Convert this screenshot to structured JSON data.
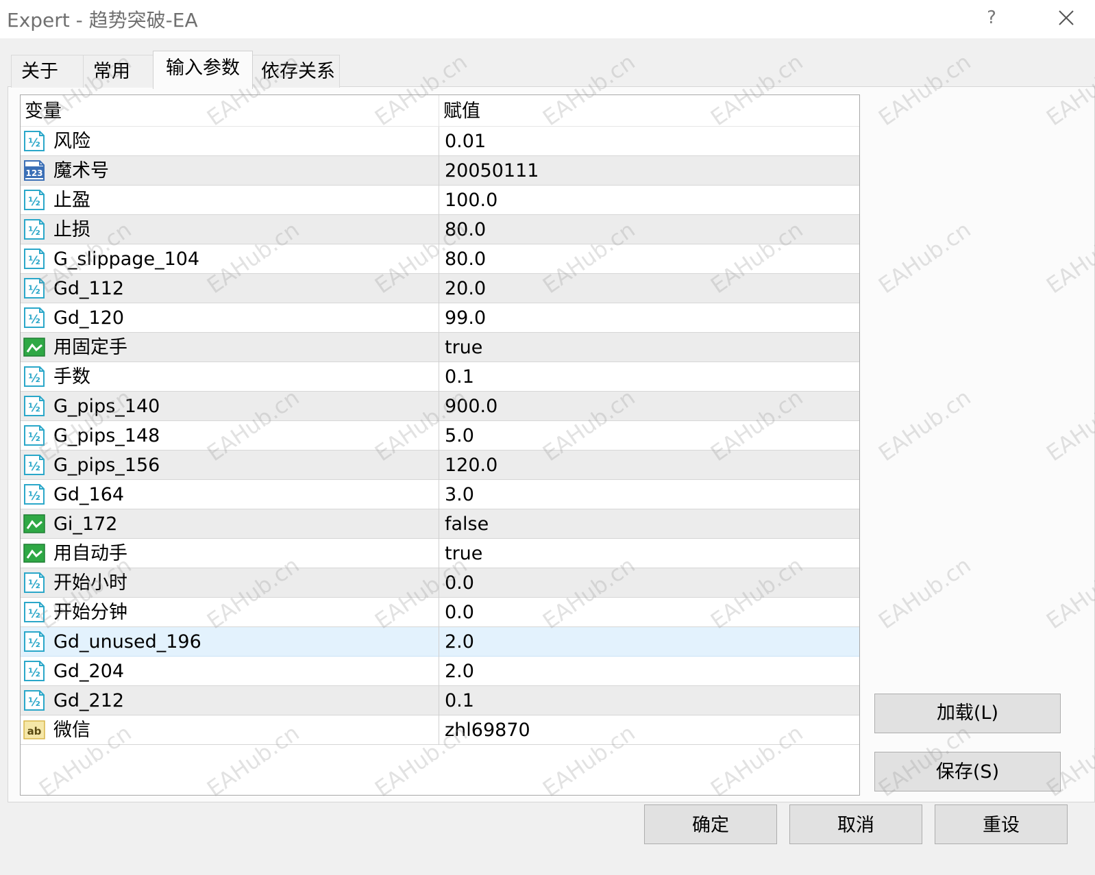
{
  "window": {
    "title": "Expert - 趋势突破-EA",
    "help_label": "?"
  },
  "tabs": [
    {
      "label": "关于"
    },
    {
      "label": "常用"
    },
    {
      "label": "输入参数",
      "active": true
    },
    {
      "label": "依存关系"
    }
  ],
  "grid": {
    "columns": [
      "变量",
      "赋值"
    ],
    "rows": [
      {
        "icon": "fraction-icon",
        "name": "风险",
        "value": "0.01"
      },
      {
        "icon": "integer-icon",
        "name": "魔术号",
        "value": "20050111"
      },
      {
        "icon": "fraction-icon",
        "name": "止盈",
        "value": "100.0"
      },
      {
        "icon": "fraction-icon",
        "name": "止损",
        "value": "80.0"
      },
      {
        "icon": "fraction-icon",
        "name": "G_slippage_104",
        "value": "80.0"
      },
      {
        "icon": "fraction-icon",
        "name": "Gd_112",
        "value": "20.0"
      },
      {
        "icon": "fraction-icon",
        "name": "Gd_120",
        "value": "99.0"
      },
      {
        "icon": "boolean-icon",
        "name": "用固定手",
        "value": "true"
      },
      {
        "icon": "fraction-icon",
        "name": "手数",
        "value": "0.1"
      },
      {
        "icon": "fraction-icon",
        "name": "G_pips_140",
        "value": "900.0"
      },
      {
        "icon": "fraction-icon",
        "name": "G_pips_148",
        "value": "5.0"
      },
      {
        "icon": "fraction-icon",
        "name": "G_pips_156",
        "value": "120.0"
      },
      {
        "icon": "fraction-icon",
        "name": "Gd_164",
        "value": "3.0"
      },
      {
        "icon": "boolean-icon",
        "name": "Gi_172",
        "value": "false"
      },
      {
        "icon": "boolean-icon",
        "name": "用自动手",
        "value": "true"
      },
      {
        "icon": "fraction-icon",
        "name": "开始小时",
        "value": "0.0"
      },
      {
        "icon": "fraction-icon",
        "name": "开始分钟",
        "value": "0.0"
      },
      {
        "icon": "fraction-icon",
        "name": "Gd_unused_196",
        "value": "2.0",
        "selected": true
      },
      {
        "icon": "fraction-icon",
        "name": "Gd_204",
        "value": "2.0"
      },
      {
        "icon": "fraction-icon",
        "name": "Gd_212",
        "value": "0.1"
      },
      {
        "icon": "string-icon",
        "name": "微信",
        "value": "zhl69870"
      }
    ]
  },
  "icon_text": {
    "fraction": "½",
    "integer": "123",
    "string": "ab"
  },
  "buttons": {
    "load": "加载(L)",
    "save": "保存(S)",
    "ok": "确定",
    "cancel": "取消",
    "reset": "重设"
  },
  "watermark": "EAHub.cn",
  "colors": {
    "fraction_icon": "#2aa7c9",
    "integer_icon": "#3b6fb6",
    "boolean_icon": "#2fa845",
    "string_icon": "#d8b64a",
    "selected_row": "#e3f2fd"
  }
}
